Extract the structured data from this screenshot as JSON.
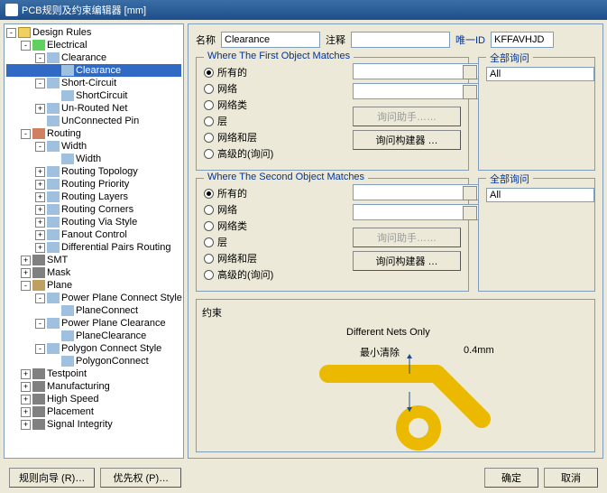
{
  "title": "PCB规则及约束编辑器 [mm]",
  "tree": {
    "root": "Design Rules",
    "electrical": "Electrical",
    "clearance": "Clearance",
    "clearance_sel": "Clearance",
    "shortcircuit": "Short-Circuit",
    "shortcircuit2": "ShortCircuit",
    "unrouted": "Un-Routed Net",
    "unconnected": "UnConnected Pin",
    "routing": "Routing",
    "width": "Width",
    "width2": "Width",
    "rtopo": "Routing Topology",
    "rprio": "Routing Priority",
    "rlayers": "Routing Layers",
    "rcorners": "Routing Corners",
    "rvia": "Routing Via Style",
    "fanout": "Fanout Control",
    "diffpair": "Differential Pairs Routing",
    "smt": "SMT",
    "mask": "Mask",
    "plane": "Plane",
    "ppconn": "Power Plane Connect Style",
    "ppconn2": "PlaneConnect",
    "ppclear": "Power Plane Clearance",
    "ppclear2": "PlaneClearance",
    "polyconn": "Polygon Connect Style",
    "polyconn2": "PolygonConnect",
    "testpoint": "Testpoint",
    "mfg": "Manufacturing",
    "hispeed": "High Speed",
    "placement": "Placement",
    "sigint": "Signal Integrity"
  },
  "labels": {
    "name": "名称",
    "comment": "注释",
    "uid": "唯一ID",
    "where1": "Where The First Object Matches",
    "where2": "Where The Second Object Matches",
    "fullquery": "全部询问",
    "all": "All",
    "r_all": "所有的",
    "r_net": "网络",
    "r_netclass": "网络类",
    "r_layer": "层",
    "r_netlayer": "网络和层",
    "r_adv": "高级的(询问)",
    "btn_qh_dis": "询问助手……",
    "btn_qb": "询问构建器 …",
    "constraint": "约束",
    "diff_nets": "Different Nets Only",
    "minclr": "最小清除",
    "val": "0.4mm"
  },
  "fields": {
    "name_val": "Clearance",
    "uid_val": "KFFAVHJD"
  },
  "footer": {
    "wizard": "规则向导 (R)…",
    "prio": "优先权 (P)…",
    "ok": "确定",
    "cancel": "取消"
  }
}
